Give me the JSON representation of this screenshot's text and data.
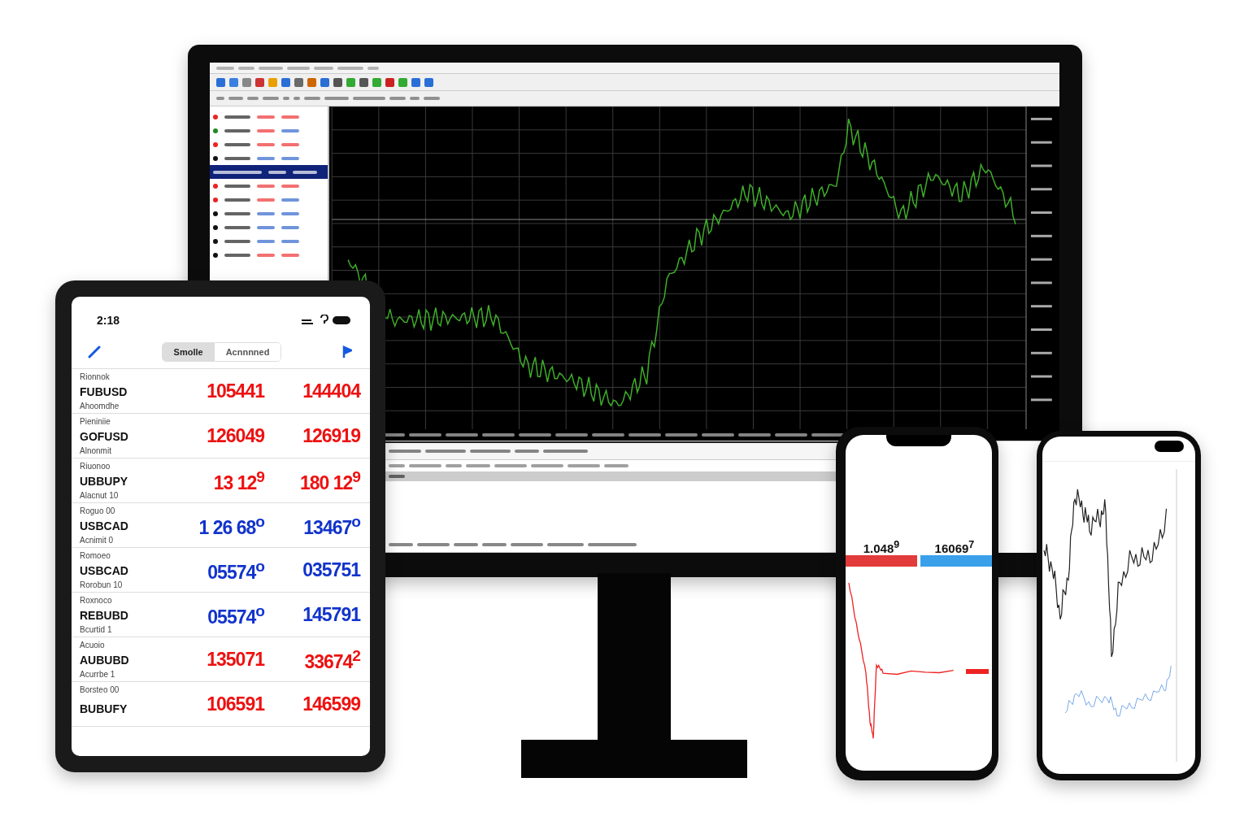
{
  "tablet": {
    "status_time": "2:18",
    "segments": [
      {
        "label": "Smolle",
        "selected": true
      },
      {
        "label": "Acnnnned",
        "selected": false
      }
    ],
    "rows": [
      {
        "label": "Rionnok",
        "symbol": "FUBUSD",
        "sub": "Ahoomdhe",
        "bid": "105441",
        "ask": "144404",
        "color": "#ee1111"
      },
      {
        "label": "Pieniniie",
        "symbol": "GOFUSD",
        "sub": "Alnonmit",
        "bid": "126049",
        "ask": "126919",
        "color": "#ee1111"
      },
      {
        "label": "Riuonoo",
        "symbol": "UBBUPY",
        "sub": "Alacnut 10",
        "bid": "13 12$^{9}$",
        "ask": "180 12$^{9}$",
        "color": "#ee1111"
      },
      {
        "label": "Roguo 00",
        "symbol": "USBCAD",
        "sub": "Acnimit 0",
        "bid": "1 26 68$^{o}$",
        "ask": "13467$^{o}$",
        "color": "#1133cc"
      },
      {
        "label": "Romoeo",
        "symbol": "USBCAD",
        "sub": "Rorobun 10",
        "bid": "05574$^{o}$",
        "ask": "035751",
        "color": "#1133cc"
      },
      {
        "label": "Roxnoco",
        "symbol": "REBUBD",
        "sub": "Bcurtid 1",
        "bid": "05574$^{o}$",
        "ask": "145791",
        "color": "#1133cc"
      },
      {
        "label": "Acuoio",
        "symbol": "AUBUBD",
        "sub": "Acurrbe 1",
        "bid": "135071",
        "ask": "33674$^{2}$",
        "color": "#ee1111"
      },
      {
        "label": "Borsteo 00",
        "symbol": "BUBUFY",
        "bid": "106591",
        "ask": "146599",
        "color": "#ee1111"
      }
    ]
  },
  "monitor": {
    "watchlist": [
      {
        "selected": false
      },
      {
        "selected": false
      },
      {
        "selected": false
      },
      {
        "selected": false
      },
      {
        "selected": true
      },
      {
        "selected": false
      },
      {
        "selected": false
      },
      {
        "selected": false
      },
      {
        "selected": false
      },
      {
        "selected": false
      },
      {
        "selected": false
      }
    ]
  },
  "phone": {
    "prices": [
      "1.048$^{9}$",
      "16069$^{7}$"
    ]
  }
}
